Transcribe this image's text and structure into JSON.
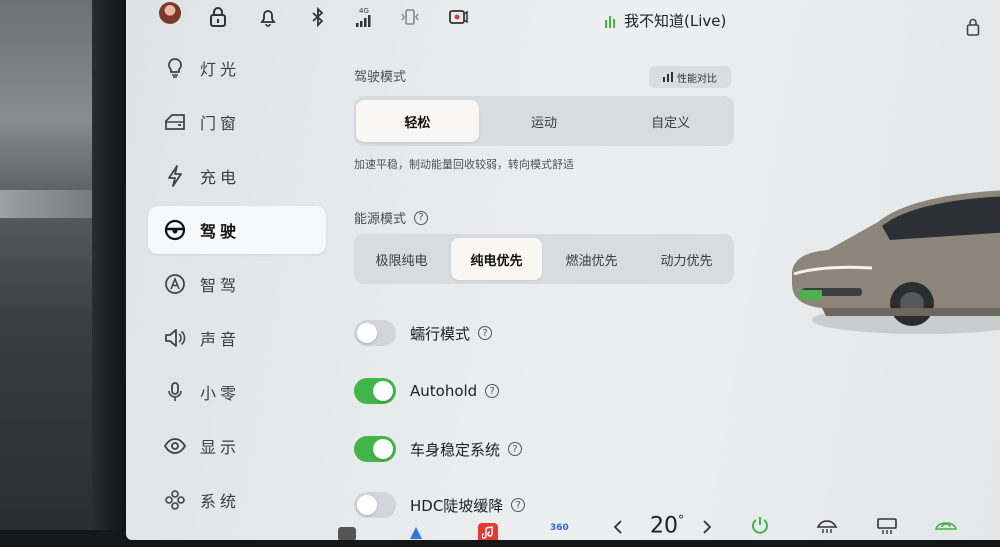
{
  "statusbar": {
    "network_label": "4G",
    "music_title": "我不知道(Live)"
  },
  "sidebar": {
    "items": [
      {
        "label": "灯光",
        "icon": "bulb-icon"
      },
      {
        "label": "门窗",
        "icon": "door-icon"
      },
      {
        "label": "充电",
        "icon": "charge-icon"
      },
      {
        "label": "驾驶",
        "icon": "steering-wheel-icon",
        "active": true
      },
      {
        "label": "智驾",
        "icon": "smart-drive-icon"
      },
      {
        "label": "声音",
        "icon": "speaker-icon"
      },
      {
        "label": "小零",
        "icon": "microphone-icon"
      },
      {
        "label": "显示",
        "icon": "eye-icon"
      },
      {
        "label": "系统",
        "icon": "system-icon"
      }
    ]
  },
  "drive_mode": {
    "title": "驾驶模式",
    "compare_label": "性能对比",
    "options": [
      "轻松",
      "运动",
      "自定义"
    ],
    "selected": "轻松",
    "description": "加速平稳，制动能量回收较弱，转向模式舒适"
  },
  "energy_mode": {
    "title": "能源模式",
    "options": [
      "极限纯电",
      "纯电优先",
      "燃油优先",
      "动力优先"
    ],
    "selected": "纯电优先"
  },
  "toggles": [
    {
      "label": "蠕行模式",
      "on": false
    },
    {
      "label": "Autohold",
      "on": true
    },
    {
      "label": "车身稳定系统",
      "on": true
    },
    {
      "label": "HDC陡坡缓降",
      "on": false
    }
  ],
  "dock": {
    "temperature": "20",
    "temperature_unit": "°",
    "app_label_360": "360"
  },
  "colors": {
    "accent_green": "#43b649",
    "screen_bg": "#e7e9ec"
  }
}
